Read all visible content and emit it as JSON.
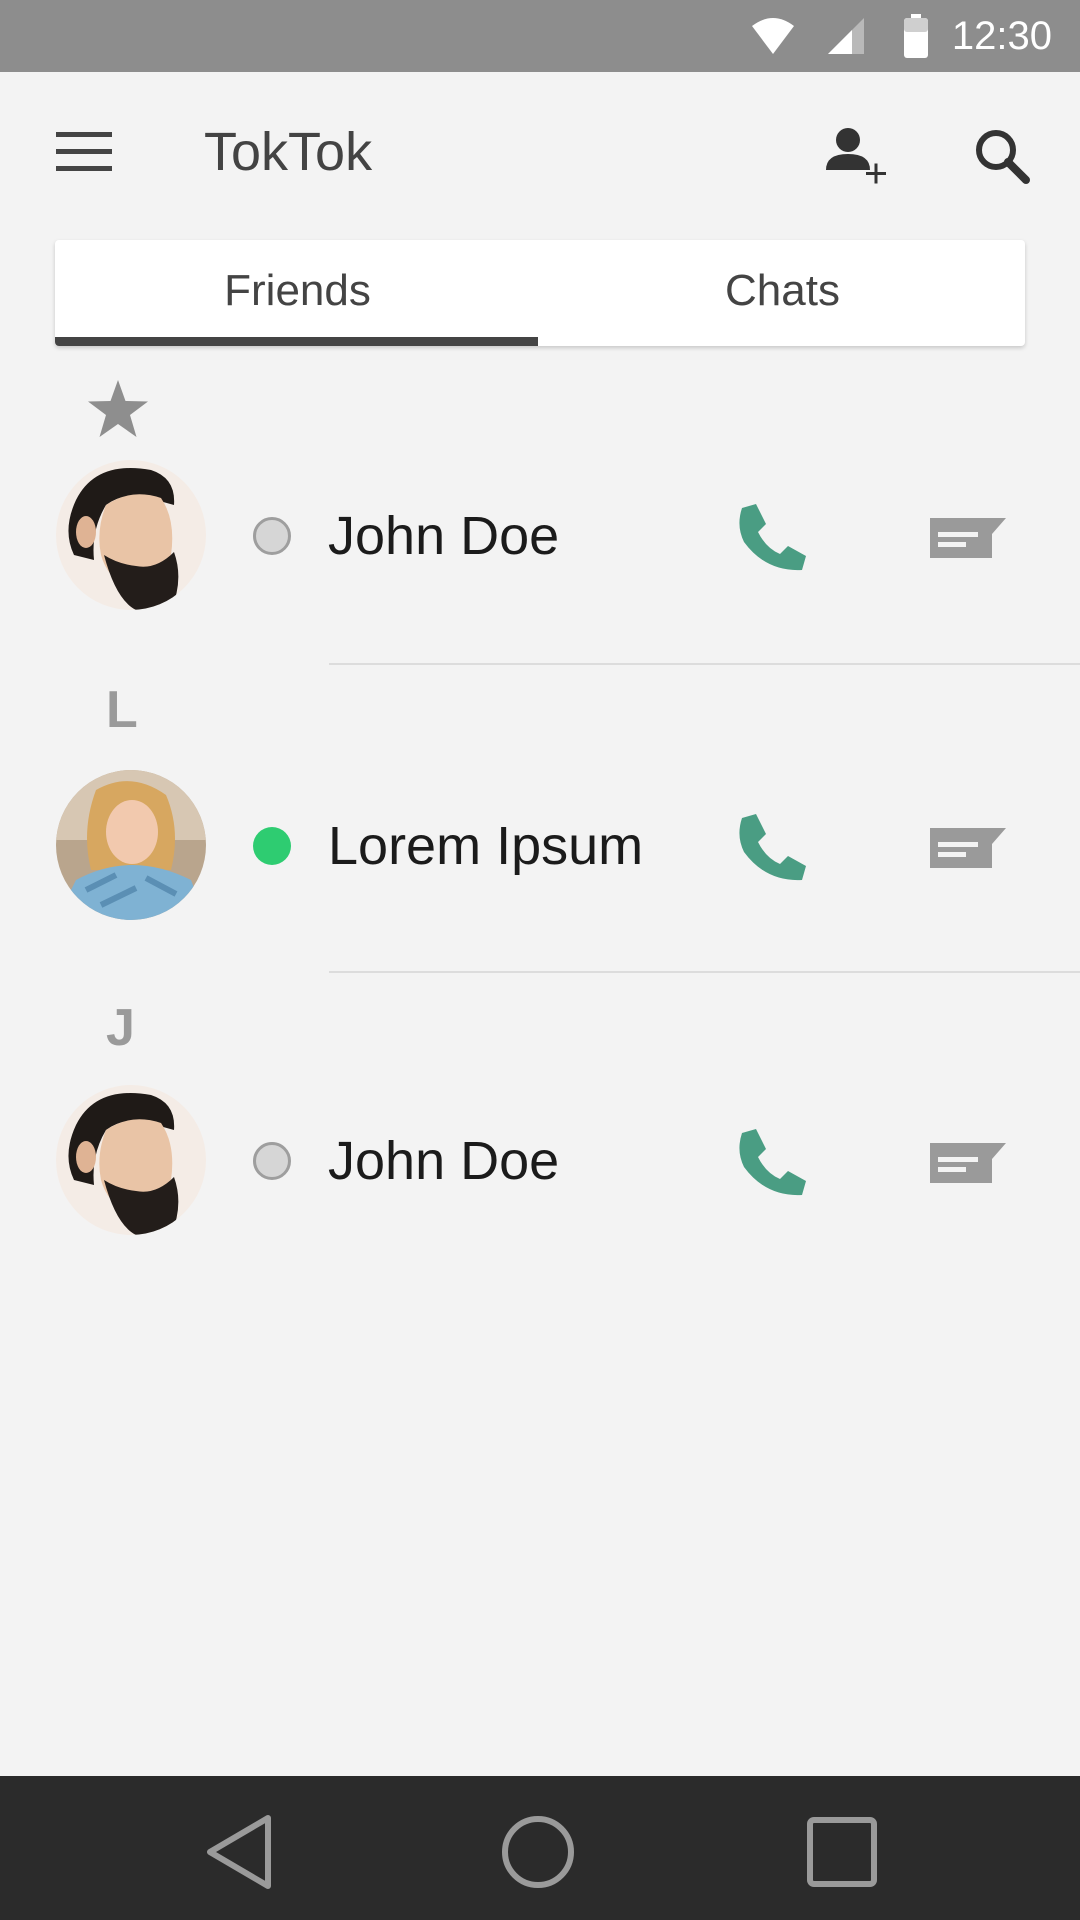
{
  "status_bar": {
    "time": "12:30",
    "icons": [
      "wifi-icon",
      "signal-icon",
      "battery-icon"
    ]
  },
  "app_bar": {
    "title": "TokTok",
    "icons": [
      "menu-icon",
      "add-friend-icon",
      "search-icon"
    ]
  },
  "tabs": [
    {
      "label": "Friends",
      "selected": true
    },
    {
      "label": "Chats",
      "selected": false
    }
  ],
  "sections": [
    {
      "header_icon": "star-icon",
      "header": "",
      "contacts": [
        {
          "name": "John Doe",
          "status": "offline",
          "avatar": "avatar-man"
        }
      ]
    },
    {
      "header": "L",
      "contacts": [
        {
          "name": "Lorem Ipsum",
          "status": "online",
          "avatar": "avatar-woman"
        }
      ]
    },
    {
      "header": "J",
      "contacts": [
        {
          "name": "John Doe",
          "status": "offline",
          "avatar": "avatar-man"
        }
      ]
    }
  ],
  "row_icons": [
    "phone-icon",
    "message-icon"
  ],
  "colors": {
    "accent_call": "#4a9d83",
    "online": "#2ecc71",
    "offline": "#d6d6d6",
    "status_bar": "#8d8d8d",
    "nav_bar": "#2b2b2b"
  },
  "nav_bar": {
    "icons": [
      "back-icon",
      "home-icon",
      "recents-icon"
    ]
  }
}
